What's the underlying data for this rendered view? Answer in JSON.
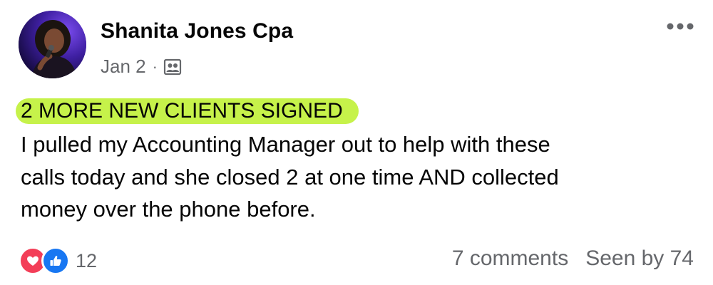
{
  "author": {
    "name": "Shanita Jones Cpa"
  },
  "meta": {
    "date": "Jan 2",
    "separator": "·",
    "audience_icon": "group-audience-icon"
  },
  "header": {
    "more_icon": "more-horizontal-icon"
  },
  "post": {
    "highlight": "2 MORE NEW CLIENTS SIGNED",
    "lines": [
      "I pulled my Accounting Manager out to help with these",
      "calls today and she closed 2 at one time AND collected",
      "money over the phone before."
    ],
    "highlight_color": "#c6f24a"
  },
  "reactions": {
    "icons": [
      "love-icon",
      "like-icon"
    ],
    "count": "12"
  },
  "stats": {
    "comments": "7 comments",
    "seen": "Seen by 74"
  },
  "colors": {
    "love": "#f33e58",
    "like": "#1877f2",
    "secondary_text": "#65676b"
  }
}
